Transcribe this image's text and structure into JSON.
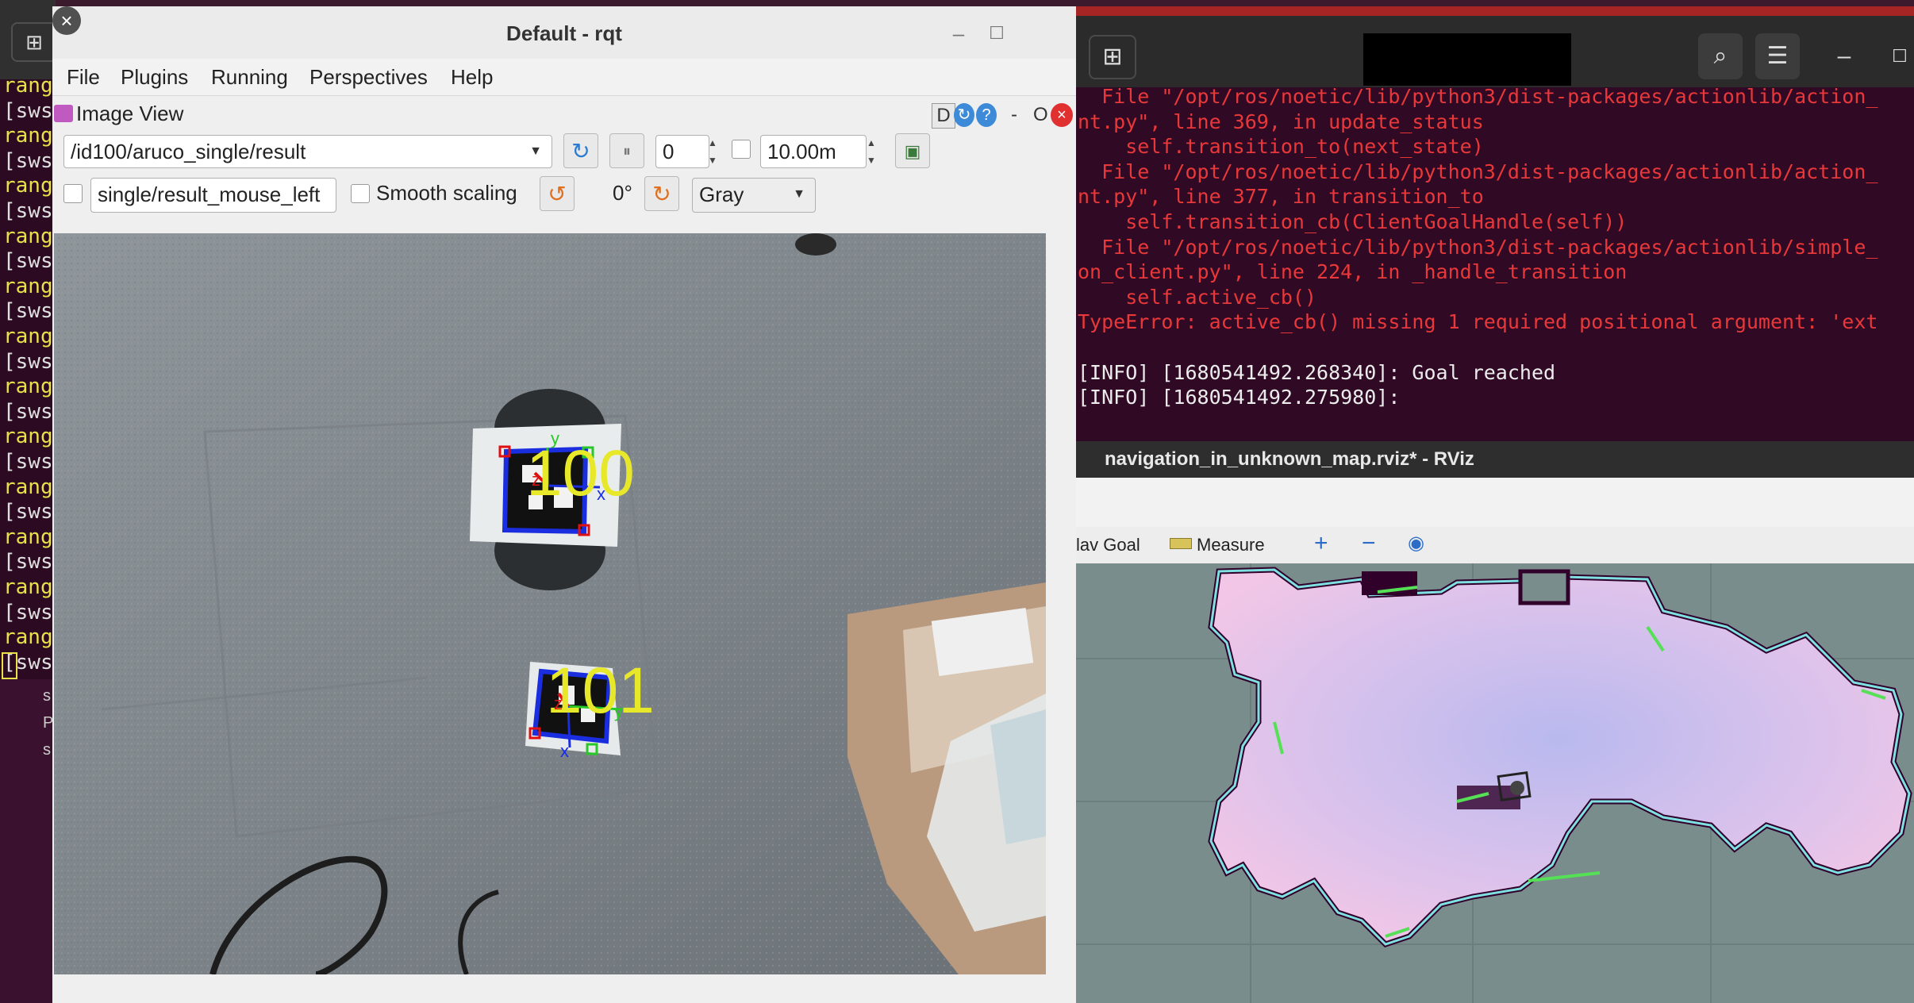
{
  "left_terminal": {
    "new_tab_icon": "new-tab-icon",
    "lines": [
      "rang",
      "[sws",
      "rang",
      "[sws",
      "rang",
      "[sws",
      "rang",
      "[sws",
      "rang",
      "[sws",
      "rang",
      "[sws",
      "rang",
      "[sws",
      "rang",
      "[sws",
      "rang",
      "[sws",
      "rang",
      "[sws",
      "rang",
      "[sws",
      "rang",
      "[sws",
      "rang",
      "[sws",
      "rang"
    ],
    "lower_text": [
      "s",
      "P",
      "s"
    ]
  },
  "rqt": {
    "title": "Default - rqt",
    "menu": [
      "File",
      "Plugins",
      "Running",
      "Perspectives",
      "Help"
    ],
    "plugin_title": "Image View",
    "plugin_buttons": {
      "d": "D",
      "dash": "-",
      "o": "O"
    },
    "topic": "/id100/aruco_single/result",
    "rate_value": "0",
    "max_range": "10.00m",
    "mouse_topic": "single/result_mouse_left",
    "smooth_scaling_label": "Smooth scaling",
    "rotation": "0°",
    "color_scheme": "Gray",
    "markers": [
      {
        "label": "100",
        "axes": [
          "y",
          "z",
          "x"
        ]
      },
      {
        "label": "101",
        "axes": [
          "z",
          "y",
          "x"
        ]
      }
    ]
  },
  "terminal": {
    "lines": [
      {
        "text": "  File \"/opt/ros/noetic/lib/python3/dist-packages/actionlib/action_",
        "style": "red"
      },
      {
        "text": "nt.py\", line 369, in update_status",
        "style": "red"
      },
      {
        "text": "    self.transition_to(next_state)",
        "style": "red"
      },
      {
        "text": "  File \"/opt/ros/noetic/lib/python3/dist-packages/actionlib/action_",
        "style": "red"
      },
      {
        "text": "nt.py\", line 377, in transition_to",
        "style": "red"
      },
      {
        "text": "    self.transition_cb(ClientGoalHandle(self))",
        "style": "red"
      },
      {
        "text": "  File \"/opt/ros/noetic/lib/python3/dist-packages/actionlib/simple_",
        "style": "red"
      },
      {
        "text": "on_client.py\", line 224, in _handle_transition",
        "style": "red"
      },
      {
        "text": "    self.active_cb()",
        "style": "red"
      },
      {
        "text": "TypeError: active_cb() missing 1 required positional argument: 'ext",
        "style": "red"
      },
      {
        "text": "",
        "style": "white"
      },
      {
        "text": "[INFO] [1680541492.268340]: Goal reached",
        "style": "white"
      },
      {
        "text": "[INFO] [1680541492.275980]:",
        "style": "white"
      }
    ]
  },
  "rviz": {
    "title": "navigation_in_unknown_map.rviz* - RViz",
    "tools": [
      "lav Goal",
      "Measure"
    ]
  }
}
